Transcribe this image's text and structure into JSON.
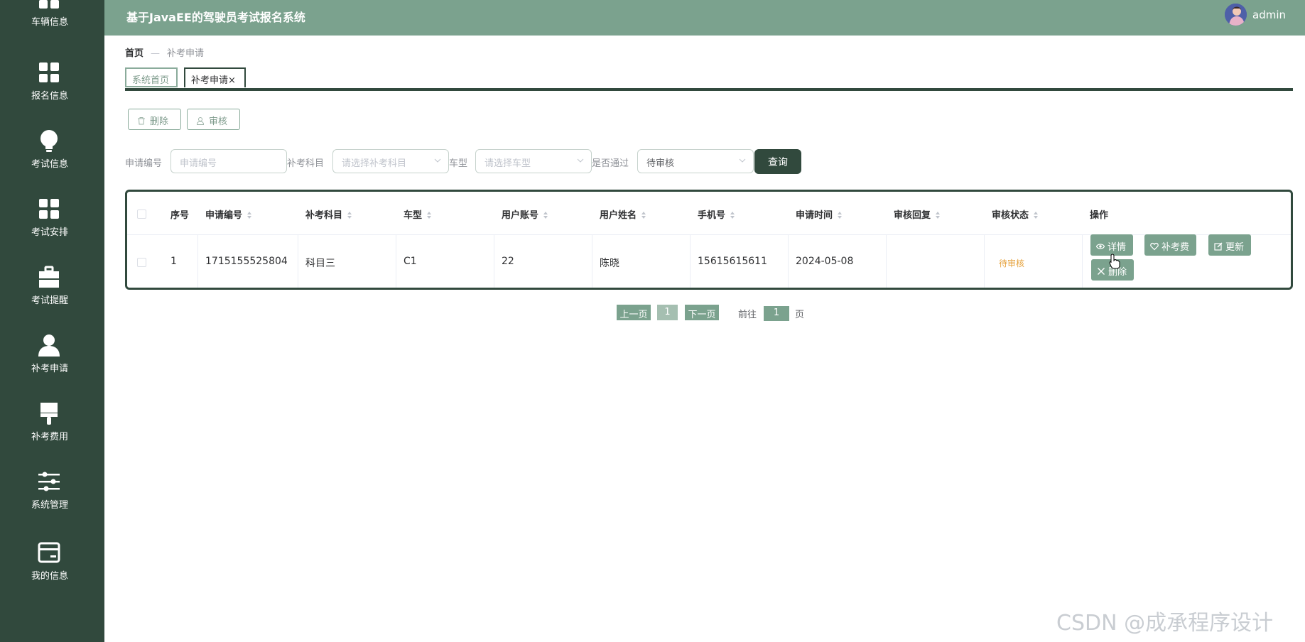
{
  "sidebar": {
    "items": [
      {
        "label": "车辆信息",
        "icon": "grid-icon"
      },
      {
        "label": "报名信息",
        "icon": "grid-icon"
      },
      {
        "label": "考试信息",
        "icon": "lightbulb-icon"
      },
      {
        "label": "考试安排",
        "icon": "grid-icon"
      },
      {
        "label": "考试提醒",
        "icon": "toolbox-icon"
      },
      {
        "label": "补考申请",
        "icon": "user-icon"
      },
      {
        "label": "补考费用",
        "icon": "brush-icon"
      },
      {
        "label": "系统管理",
        "icon": "sliders-icon"
      },
      {
        "label": "我的信息",
        "icon": "card-icon"
      }
    ]
  },
  "header": {
    "title": "基于JavaEE的驾驶员考试报名系统",
    "username": "admin"
  },
  "breadcrumb": {
    "home": "首页",
    "separator": "—",
    "current": "补考申请"
  },
  "tabs": [
    {
      "label": "系统首页",
      "active": false
    },
    {
      "label": "补考申请",
      "active": true,
      "close": "×"
    }
  ],
  "toolbar": {
    "delete_label": "删除",
    "audit_label": "审核"
  },
  "filters": {
    "app_no_label": "申请编号",
    "app_no_placeholder": "申请编号",
    "subject_label": "补考科目",
    "subject_placeholder": "请选择补考科目",
    "car_type_label": "车型",
    "car_type_placeholder": "请选择车型",
    "passed_label": "是否通过",
    "passed_value": "待审核",
    "query_label": "查询"
  },
  "table": {
    "columns": [
      "序号",
      "申请编号",
      "补考科目",
      "车型",
      "用户账号",
      "用户姓名",
      "手机号",
      "申请时间",
      "审核回复",
      "审核状态",
      "操作"
    ],
    "rows": [
      {
        "index": "1",
        "app_no": "1715155525804",
        "subject": "科目三",
        "car_type": "C1",
        "account": "22",
        "name": "陈晓",
        "phone": "15615615611",
        "date": "2024-05-08",
        "reply": "",
        "status": "待审核"
      }
    ],
    "actions": {
      "detail": "详情",
      "fee": "补考费",
      "update": "更新",
      "delete": "删除"
    }
  },
  "pagination": {
    "prev": "上一页",
    "page": "1",
    "next": "下一页",
    "goto_label": "前往",
    "goto_value": "1",
    "page_suffix": "页"
  },
  "watermark": "CSDN @成承程序设计",
  "colors": {
    "sidebar": "#31493d",
    "header": "#7ba28e",
    "accent": "#7ba28e",
    "pending": "#e6a23c"
  }
}
